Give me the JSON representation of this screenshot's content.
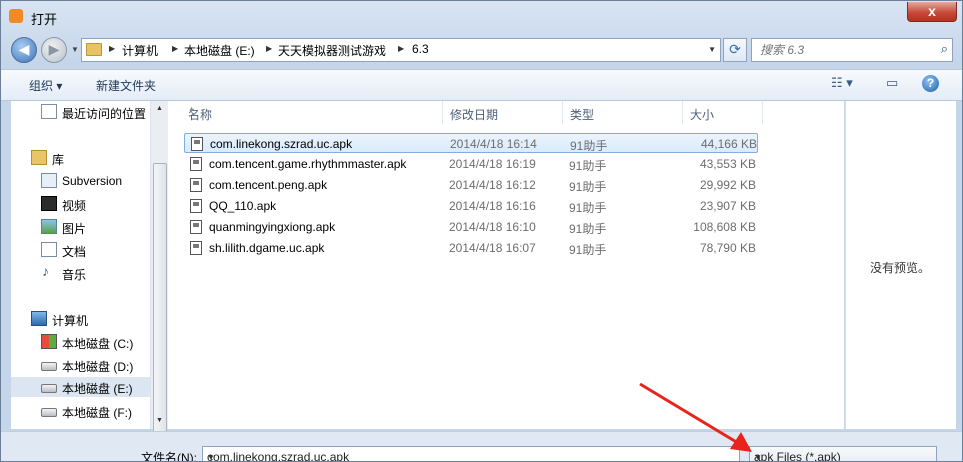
{
  "window": {
    "title": "打开",
    "close_label": "x"
  },
  "address": {
    "crumbs": [
      "计算机",
      "本地磁盘 (E:)",
      "天天模拟器测试游戏",
      "6.3"
    ],
    "search_placeholder": "搜索 6.3"
  },
  "toolbar": {
    "organize": "组织 ▾",
    "new_folder": "新建文件夹"
  },
  "nav": {
    "items": [
      {
        "label": "最近访问的位置",
        "icon": "recent-places-icon"
      },
      {
        "label": "库",
        "icon": "library-icon"
      },
      {
        "label": "Subversion",
        "icon": "subversion-icon"
      },
      {
        "label": "视频",
        "icon": "video-icon"
      },
      {
        "label": "图片",
        "icon": "pictures-icon"
      },
      {
        "label": "文档",
        "icon": "documents-icon"
      },
      {
        "label": "音乐",
        "icon": "music-icon"
      },
      {
        "label": "计算机",
        "icon": "computer-icon"
      },
      {
        "label": "本地磁盘 (C:)",
        "icon": "windows-drive-icon"
      },
      {
        "label": "本地磁盘 (D:)",
        "icon": "drive-icon"
      },
      {
        "label": "本地磁盘 (E:)",
        "icon": "drive-icon"
      },
      {
        "label": "本地磁盘 (F:)",
        "icon": "drive-icon"
      }
    ]
  },
  "columns": {
    "name": "名称",
    "date": "修改日期",
    "type": "类型",
    "size": "大小"
  },
  "files": [
    {
      "name": "com.linekong.szrad.uc.apk",
      "date": "2014/4/18 16:14",
      "type": "91助手",
      "size": "44,166 KB"
    },
    {
      "name": "com.tencent.game.rhythmmaster.apk",
      "date": "2014/4/18 16:19",
      "type": "91助手",
      "size": "43,553 KB"
    },
    {
      "name": "com.tencent.peng.apk",
      "date": "2014/4/18 16:12",
      "type": "91助手",
      "size": "29,992 KB"
    },
    {
      "name": "QQ_110.apk",
      "date": "2014/4/18 16:16",
      "type": "91助手",
      "size": "23,907 KB"
    },
    {
      "name": "quanmingyingxiong.apk",
      "date": "2014/4/18 16:10",
      "type": "91助手",
      "size": "108,608 KB"
    },
    {
      "name": "sh.lilith.dgame.uc.apk",
      "date": "2014/4/18 16:07",
      "type": "91助手",
      "size": "78,790 KB"
    }
  ],
  "preview": {
    "empty_text": "没有预览。"
  },
  "footer": {
    "filename_label": "文件名(N):",
    "filename_value": "com.linekong.szrad.uc.apk",
    "filetype_value": "apk Files (*.apk)"
  },
  "colors": {
    "annotation_arrow": "#e8241c",
    "selection": "#d9ebfc"
  }
}
